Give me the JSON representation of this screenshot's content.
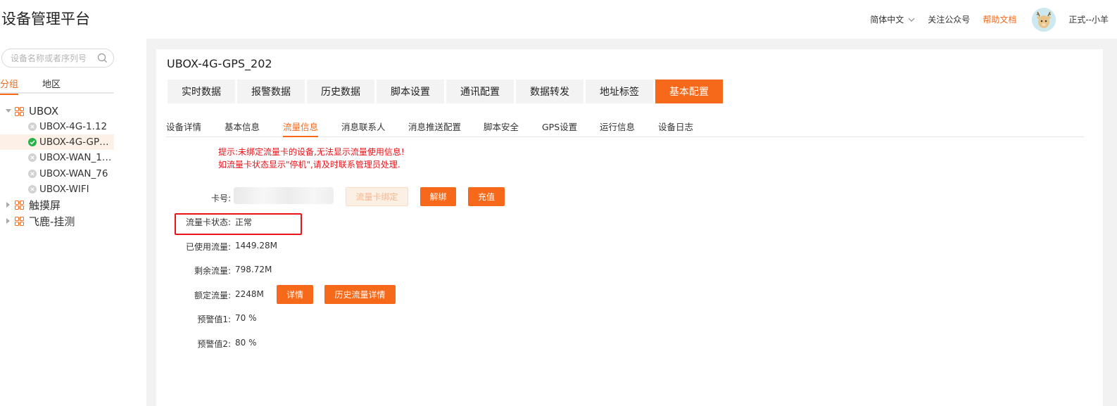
{
  "header": {
    "app_title": "设备管理平台",
    "language": "简体中文",
    "follow": "关注公众号",
    "help": "帮助文档",
    "user": "正式--小羊",
    "accent_color": "#f6681a"
  },
  "sidebar": {
    "search_placeholder": "设备名称或者序列号",
    "tabs": [
      "分组",
      "地区"
    ],
    "active_tab": "分组",
    "groups": [
      {
        "label": "UBOX",
        "expanded": true,
        "devices": [
          {
            "label": "UBOX-4G-1.12",
            "status": "offline"
          },
          {
            "label": "UBOX-4G-GPS…",
            "status": "online",
            "selected": true
          },
          {
            "label": "UBOX-WAN_1.…",
            "status": "offline"
          },
          {
            "label": "UBOX-WAN_76",
            "status": "offline"
          },
          {
            "label": "UBOX-WIFI",
            "status": "offline"
          }
        ]
      },
      {
        "label": "触摸屏",
        "expanded": false
      },
      {
        "label": "飞鹿-挂测",
        "expanded": false
      }
    ]
  },
  "main": {
    "device_title": "UBOX-4G-GPS_202",
    "tabs": [
      "实时数据",
      "报警数据",
      "历史数据",
      "脚本设置",
      "通讯配置",
      "数据转发",
      "地址标签",
      "基本配置"
    ],
    "active_tab": "基本配置",
    "sub_tabs": [
      "设备详情",
      "基本信息",
      "流量信息",
      "消息联系人",
      "消息推送配置",
      "脚本安全",
      "GPS设置",
      "运行信息",
      "设备日志"
    ],
    "active_sub_tab": "流量信息",
    "hints": [
      "提示:未绑定流量卡的设备,无法显示流量使用信息!",
      "如流量卡状态显示\"停机\",请及时联系管理员处理."
    ],
    "fields": {
      "card_label": "卡号:",
      "bind_button": "流量卡绑定",
      "unbind_button": "解绑",
      "recharge_button": "充值",
      "status_label": "流量卡状态:",
      "status_value": "正常",
      "used_label": "已使用流量:",
      "used_value": "1449.28M",
      "remaining_label": "剩余流量:",
      "remaining_value": "798.72M",
      "rated_label": "额定流量:",
      "rated_value": "2248M",
      "detail_button": "详情",
      "history_button": "历史流量详情",
      "warn1_label": "预警值1:",
      "warn1_value": "70 %",
      "warn2_label": "预警值2:",
      "warn2_value": "80 %"
    }
  }
}
